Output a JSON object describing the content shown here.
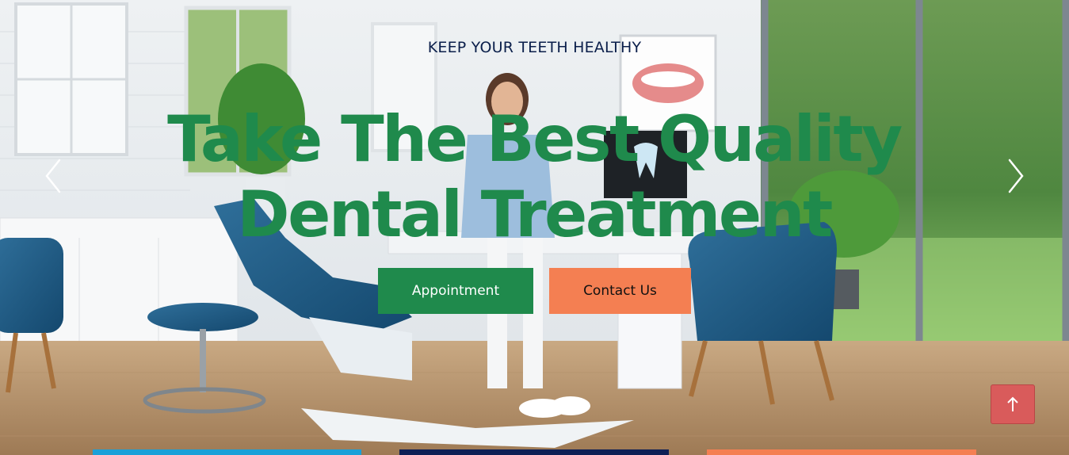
{
  "hero": {
    "eyebrow": "KEEP YOUR TEETH HEALTHY",
    "headline": "Take The Best Quality Dental Treatment",
    "background_description_icon": "dental-office-photo"
  },
  "buttons": {
    "appointment": "Appointment",
    "contact": "Contact Us"
  },
  "carousel": {
    "prev_icon": "chevron-left-icon",
    "next_icon": "chevron-right-icon"
  },
  "back_to_top_icon": "arrow-up-icon",
  "colors": {
    "primary_green": "#1f8a4c",
    "accent_orange": "#f47f52",
    "navy": "#0d1f55",
    "sky_blue": "#1aa0d8",
    "back_to_top": "#d95b5b"
  }
}
